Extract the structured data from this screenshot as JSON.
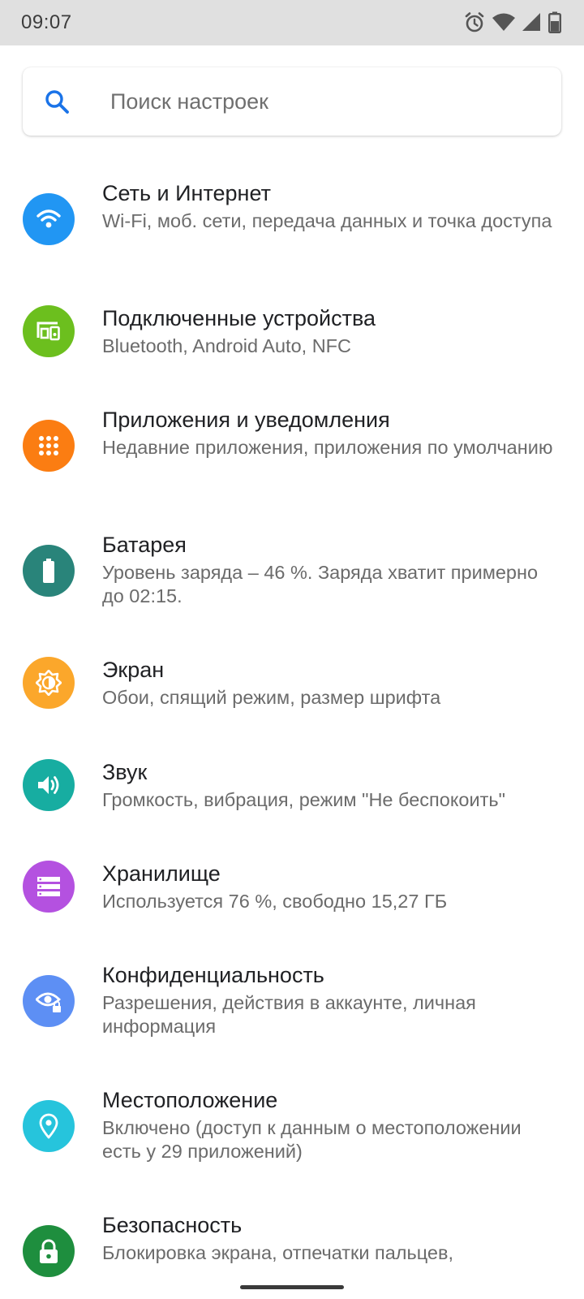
{
  "status_bar": {
    "time": "09:07",
    "icons": [
      "alarm-icon",
      "wifi-icon",
      "cellular-signal-icon",
      "battery-icon"
    ]
  },
  "search": {
    "placeholder": "Поиск настроек",
    "icon": "search-icon",
    "accent_color": "#1a73e8"
  },
  "settings": [
    {
      "title": "Сеть и Интернет",
      "subtitle": "Wi-Fi, моб. сети, передача данных и точка доступа",
      "icon": "wifi-icon",
      "color": "#2196f3"
    },
    {
      "title": "Подключенные устройства",
      "subtitle": "Bluetooth, Android Auto, NFC",
      "icon": "connected-devices-icon",
      "color": "#6cbf1e"
    },
    {
      "title": "Приложения и уведомления",
      "subtitle": "Недавние приложения, приложения по умолчанию",
      "icon": "apps-grid-icon",
      "color": "#fb7d12"
    },
    {
      "title": "Батарея",
      "subtitle": "Уровень заряда – 46 %. Заряда хватит примерно до 02:15.",
      "icon": "battery-icon",
      "color": "#29847a"
    },
    {
      "title": "Экран",
      "subtitle": "Обои, спящий режим, размер шрифта",
      "icon": "brightness-icon",
      "color": "#fba72b"
    },
    {
      "title": "Звук",
      "subtitle": "Громкость, вибрация, режим \"Не беспокоить\"",
      "icon": "volume-icon",
      "color": "#17ada1"
    },
    {
      "title": "Хранилище",
      "subtitle": "Используется 76 %, свободно 15,27 ГБ",
      "icon": "storage-icon",
      "color": "#b451e0"
    },
    {
      "title": "Конфиденциальность",
      "subtitle": "Разрешения, действия в аккаунте, личная информация",
      "icon": "privacy-eye-lock-icon",
      "color": "#5d8ff4"
    },
    {
      "title": "Местоположение",
      "subtitle": "Включено (доступ к данным о местоположении есть у 29 приложений)",
      "icon": "location-pin-icon",
      "color": "#26c4dc"
    },
    {
      "title": "Безопасность",
      "subtitle": "Блокировка экрана, отпечатки пальцев,",
      "icon": "lock-icon",
      "color": "#1e8e3e"
    }
  ]
}
